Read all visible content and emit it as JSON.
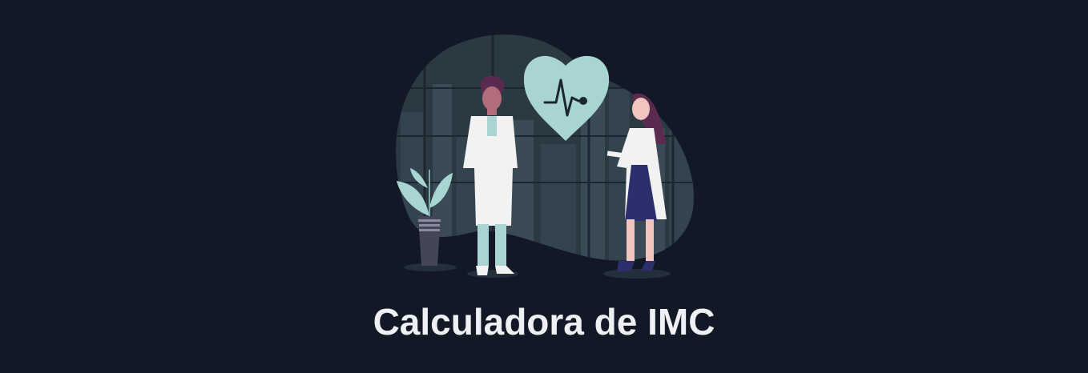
{
  "banner": {
    "title": "Calculadora de IMC",
    "illustration": {
      "description_icons": [
        "heart-pulse-icon",
        "plant-icon",
        "doctor-man",
        "doctor-woman",
        "city-skyline"
      ]
    }
  },
  "colors": {
    "background": "#121826",
    "title": "#eef0f3",
    "accent_mint": "#a8d5d3",
    "blob": "#2b3942"
  }
}
